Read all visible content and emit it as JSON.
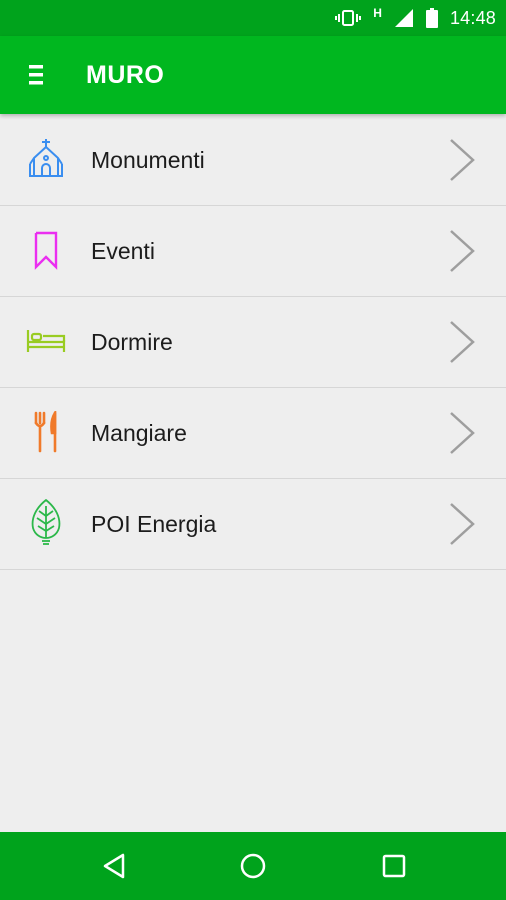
{
  "status_bar": {
    "time": "14:48",
    "network_label": "H",
    "icons": [
      "vibrate-icon",
      "network-h-icon",
      "signal-icon",
      "battery-icon"
    ]
  },
  "app_bar": {
    "title": "MURO",
    "menu_icon": "menu-icon",
    "color": "#00b71f"
  },
  "menu": {
    "items": [
      {
        "label": "Monumenti",
        "icon": "church-icon",
        "color": "#3a8ef0"
      },
      {
        "label": "Eventi",
        "icon": "bookmark-icon",
        "color": "#ea2ef0"
      },
      {
        "label": "Dormire",
        "icon": "bed-icon",
        "color": "#99cc22"
      },
      {
        "label": "Mangiare",
        "icon": "fork-knife-icon",
        "color": "#f07a2a"
      },
      {
        "label": "POI Energia",
        "icon": "leaf-bulb-icon",
        "color": "#2cb84a"
      }
    ]
  },
  "nav_bar": {
    "buttons": [
      "back-icon",
      "home-icon",
      "recents-icon"
    ]
  }
}
